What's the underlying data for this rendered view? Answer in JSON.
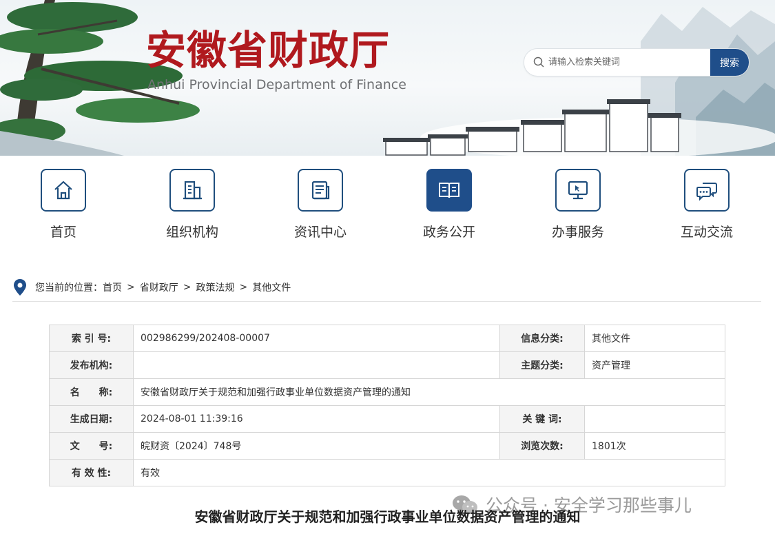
{
  "site": {
    "title": "安徽省财政厅",
    "subtitle": "Anhui Provincial Department of Finance"
  },
  "search": {
    "placeholder": "请输入检索关键词",
    "button_label": "搜索"
  },
  "nav": {
    "items": [
      {
        "label": "首页",
        "icon": "home-icon",
        "active": false
      },
      {
        "label": "组织机构",
        "icon": "building-icon",
        "active": false
      },
      {
        "label": "资讯中心",
        "icon": "news-icon",
        "active": false
      },
      {
        "label": "政务公开",
        "icon": "open-book-icon",
        "active": true
      },
      {
        "label": "办事服务",
        "icon": "monitor-cursor-icon",
        "active": false
      },
      {
        "label": "互动交流",
        "icon": "chat-bubbles-icon",
        "active": false
      }
    ]
  },
  "breadcrumb": {
    "prefix": "您当前的位置：",
    "items": [
      "首页",
      "省财政厅",
      "政策法规",
      "其他文件"
    ],
    "separator": ">"
  },
  "info": {
    "index_label": "索 引 号:",
    "index_value": "002986299/202408-00007",
    "category_label": "信息分类:",
    "category_value": "其他文件",
    "publisher_label": "发布机构:",
    "publisher_value": "",
    "topic_label": "主题分类:",
    "topic_value": "资产管理",
    "name_label": "名　　称:",
    "name_value": "安徽省财政厅关于规范和加强行政事业单位数据资产管理的通知",
    "date_label": "生成日期:",
    "date_value": "2024-08-01 11:39:16",
    "keywords_label": "关 键 词:",
    "keywords_value": "",
    "docno_label": "文　　号:",
    "docno_value": "皖财资〔2024〕748号",
    "views_label": "浏览次数:",
    "views_value": "1801次",
    "validity_label": "有 效 性:",
    "validity_value": "有效"
  },
  "document": {
    "title": "安徽省财政厅关于规范和加强行政事业单位数据资产管理的通知"
  },
  "watermark": {
    "text": "公众号 · 安全学习那些事儿"
  },
  "colors": {
    "brand_red": "#b0191e",
    "primary_blue": "#1f4e8a",
    "icon_border": "#1f4e7d"
  }
}
